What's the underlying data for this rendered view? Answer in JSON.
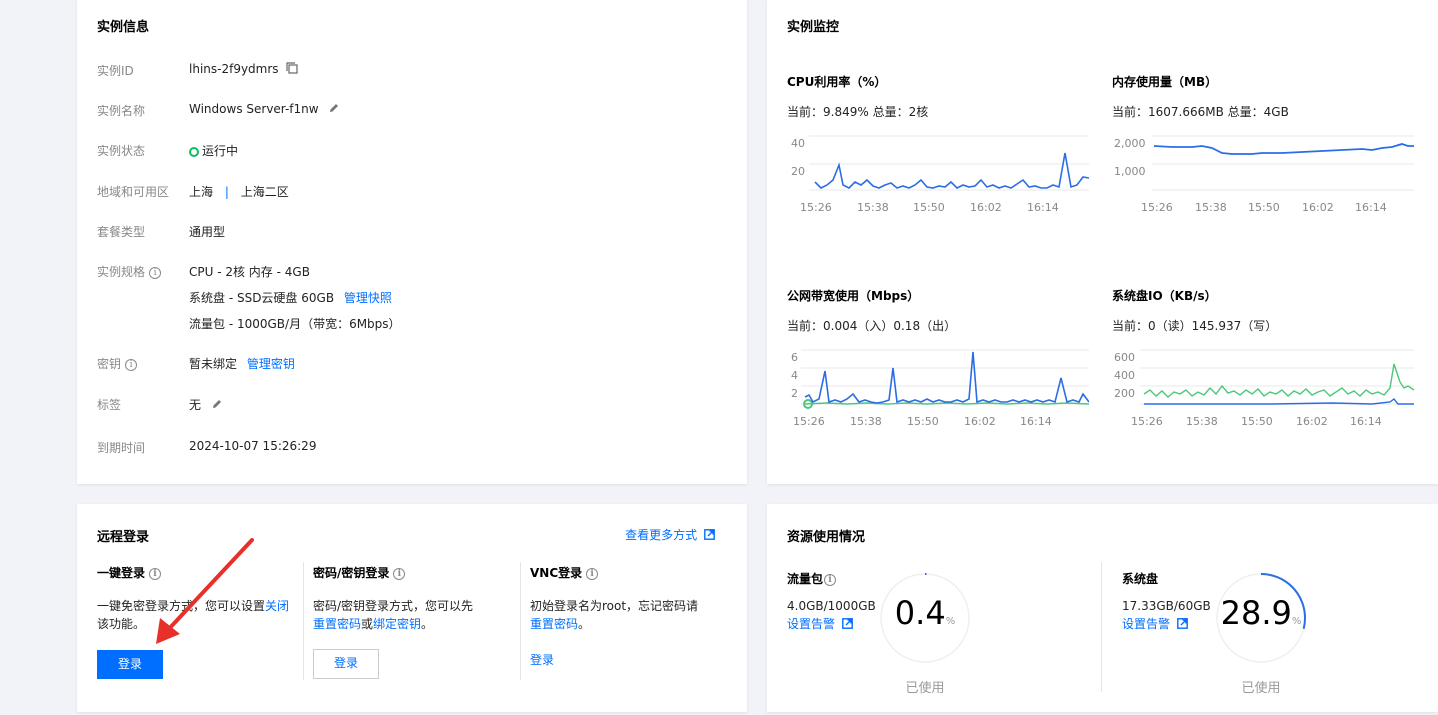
{
  "instance_info": {
    "title": "实例信息",
    "id_label": "实例ID",
    "id_value": "lhins-2f9ydmrs",
    "name_label": "实例名称",
    "name_value": "Windows Server-f1nw",
    "status_label": "实例状态",
    "status_value": "运行中",
    "region_label": "地域和可用区",
    "region_value": "上海",
    "region_sep": "|",
    "zone_value": "上海二区",
    "plan_label": "套餐类型",
    "plan_value": "通用型",
    "spec_label": "实例规格",
    "spec_cpu": "CPU - 2核 内存 - 4GB",
    "spec_disk": "系统盘 - SSD云硬盘 60GB",
    "spec_disk_link": "管理快照",
    "spec_traffic": "流量包 - 1000GB/月（带宽：6Mbps）",
    "key_label": "密钥",
    "key_value": "暂未绑定",
    "key_link": "管理密钥",
    "tag_label": "标签",
    "tag_value": "无",
    "expire_label": "到期时间",
    "expire_value": "2024-10-07 15:26:29"
  },
  "monitor": {
    "title": "实例监控",
    "cpu": {
      "title": "CPU利用率（%）",
      "current": "当前：9.849% 总量：2核",
      "yticks": [
        "40",
        "20"
      ],
      "xticks": [
        "15:26",
        "15:38",
        "15:50",
        "16:02",
        "16:14"
      ]
    },
    "mem": {
      "title": "内存使用量（MB）",
      "current": "当前：1607.666MB 总量：4GB",
      "yticks": [
        "2,000",
        "1,000"
      ],
      "xticks": [
        "15:26",
        "15:38",
        "15:50",
        "16:02",
        "16:14"
      ]
    },
    "net": {
      "title": "公网带宽使用（Mbps）",
      "current": "当前：0.004（入）0.18（出）",
      "yticks": [
        "6",
        "4",
        "2"
      ],
      "xticks": [
        "15:26",
        "15:38",
        "15:50",
        "16:02",
        "16:14"
      ]
    },
    "disk": {
      "title": "系统盘IO（KB/s）",
      "current": "当前：0（读）145.937（写）",
      "yticks": [
        "600",
        "400",
        "200"
      ],
      "xticks": [
        "15:26",
        "15:38",
        "15:50",
        "16:02",
        "16:14"
      ]
    }
  },
  "remote_login": {
    "title": "远程登录",
    "more_link": "查看更多方式",
    "one_click": {
      "title": "一键登录",
      "desc_a": "一键免密登录方式，您可以设置",
      "desc_link": "关闭",
      "desc_b": "该功能。",
      "button": "登录"
    },
    "password": {
      "title": "密码/密钥登录",
      "desc_a": "密码/密钥登录方式，您可以先",
      "link_a": "重置密码",
      "desc_or": "或",
      "link_b": "绑定密钥",
      "desc_end": "。",
      "button": "登录"
    },
    "vnc": {
      "title": "VNC登录",
      "desc_a": "初始登录名为root，忘记密码请",
      "link_a": "重置密码",
      "desc_end": "。",
      "button": "登录"
    }
  },
  "resource": {
    "title": "资源使用情况",
    "traffic": {
      "title": "流量包",
      "usage": "4.0GB/1000GB",
      "alert": "设置告警",
      "percent": "0.4",
      "unit": "%",
      "caption": "已使用",
      "value": 0.4
    },
    "disk": {
      "title": "系统盘",
      "usage": "17.33GB/60GB",
      "alert": "设置告警",
      "percent": "28.9",
      "unit": "%",
      "caption": "已使用",
      "value": 28.9
    }
  },
  "colors": {
    "accent": "#006eff",
    "line_blue": "#2b6de5",
    "line_green": "#4cc87a",
    "status_green": "#0abf5b",
    "arrow_red": "#e8302a"
  }
}
